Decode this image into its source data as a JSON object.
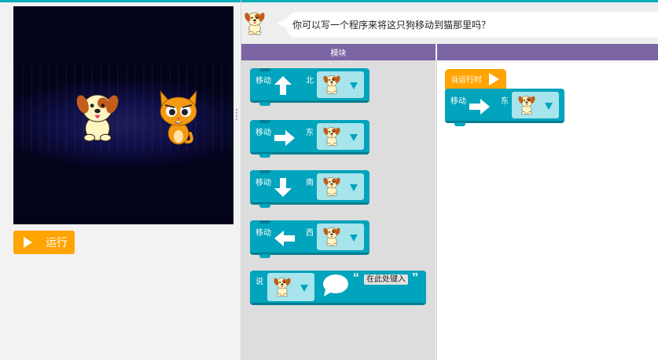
{
  "instruction": {
    "text": "你可以写一个程序来将这只狗移动到猫那里吗？"
  },
  "headers": {
    "toolbox": "模块",
    "workspace": ""
  },
  "run_button": {
    "label": "运行"
  },
  "toolbox": {
    "move_blocks": [
      {
        "label": "移动",
        "direction": "北",
        "arrow": "up-arrow-icon",
        "sprite": "dog"
      },
      {
        "label": "移动",
        "direction": "东",
        "arrow": "right-arrow-icon",
        "sprite": "dog"
      },
      {
        "label": "移动",
        "direction": "南",
        "arrow": "down-arrow-icon",
        "sprite": "dog"
      },
      {
        "label": "移动",
        "direction": "西",
        "arrow": "left-arrow-icon",
        "sprite": "dog"
      }
    ],
    "say_block": {
      "label": "说",
      "sprite": "dog",
      "open_quote": "“",
      "placeholder": "在此处键入",
      "close_quote": "”"
    }
  },
  "workspace": {
    "when_run": {
      "label": "当运行时"
    },
    "move_block": {
      "label": "移动",
      "direction": "东",
      "arrow": "right-arrow-icon",
      "sprite": "dog"
    }
  },
  "colors": {
    "accent": "#00adbc",
    "block": "#00a4bc",
    "block_dark": "#007e91",
    "header": "#7c65a4",
    "run": "#ffa400",
    "stage_bg": "#0a0a35",
    "dog_body": "#fff5c2",
    "dog_ears": "#c25d1b",
    "cat_body": "#f49a10"
  }
}
